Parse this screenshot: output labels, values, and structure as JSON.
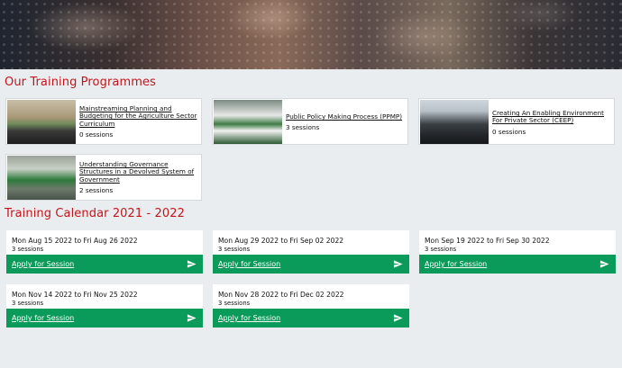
{
  "programmes": {
    "heading": "Our Training Programmes",
    "items": [
      {
        "title": "Mainstreaming Planning and Budgeting for the Agriculture Sector Curriculum",
        "sessions": "0 sessions"
      },
      {
        "title": "Public Policy Making Process (PPMP)",
        "sessions": "3 sessions"
      },
      {
        "title": "Creating An Enabling Environment For Private Sector (CEEP)",
        "sessions": "0 sessions"
      },
      {
        "title": "Understanding Governance Structures in a Devolved System of Government",
        "sessions": "2 sessions"
      }
    ]
  },
  "calendar": {
    "heading": "Training Calendar 2021 - 2022",
    "apply_label": "Apply for Session",
    "items": [
      {
        "range": "Mon Aug 15 2022 to Fri Aug 26 2022",
        "sessions": "3 sessions"
      },
      {
        "range": "Mon Aug 29 2022 to Fri Sep 02 2022",
        "sessions": "3 sessions"
      },
      {
        "range": "Mon Sep 19 2022 to Fri Sep 30 2022",
        "sessions": "3 sessions"
      },
      {
        "range": "Mon Nov 14 2022 to Fri Nov 25 2022",
        "sessions": "3 sessions"
      },
      {
        "range": "Mon Nov 28 2022 to Fri Dec 02 2022",
        "sessions": "3 sessions"
      }
    ]
  },
  "colors": {
    "accent_red": "#c0161b",
    "apply_green": "#0a9a5a"
  },
  "icons": {
    "apply": "send-icon"
  }
}
